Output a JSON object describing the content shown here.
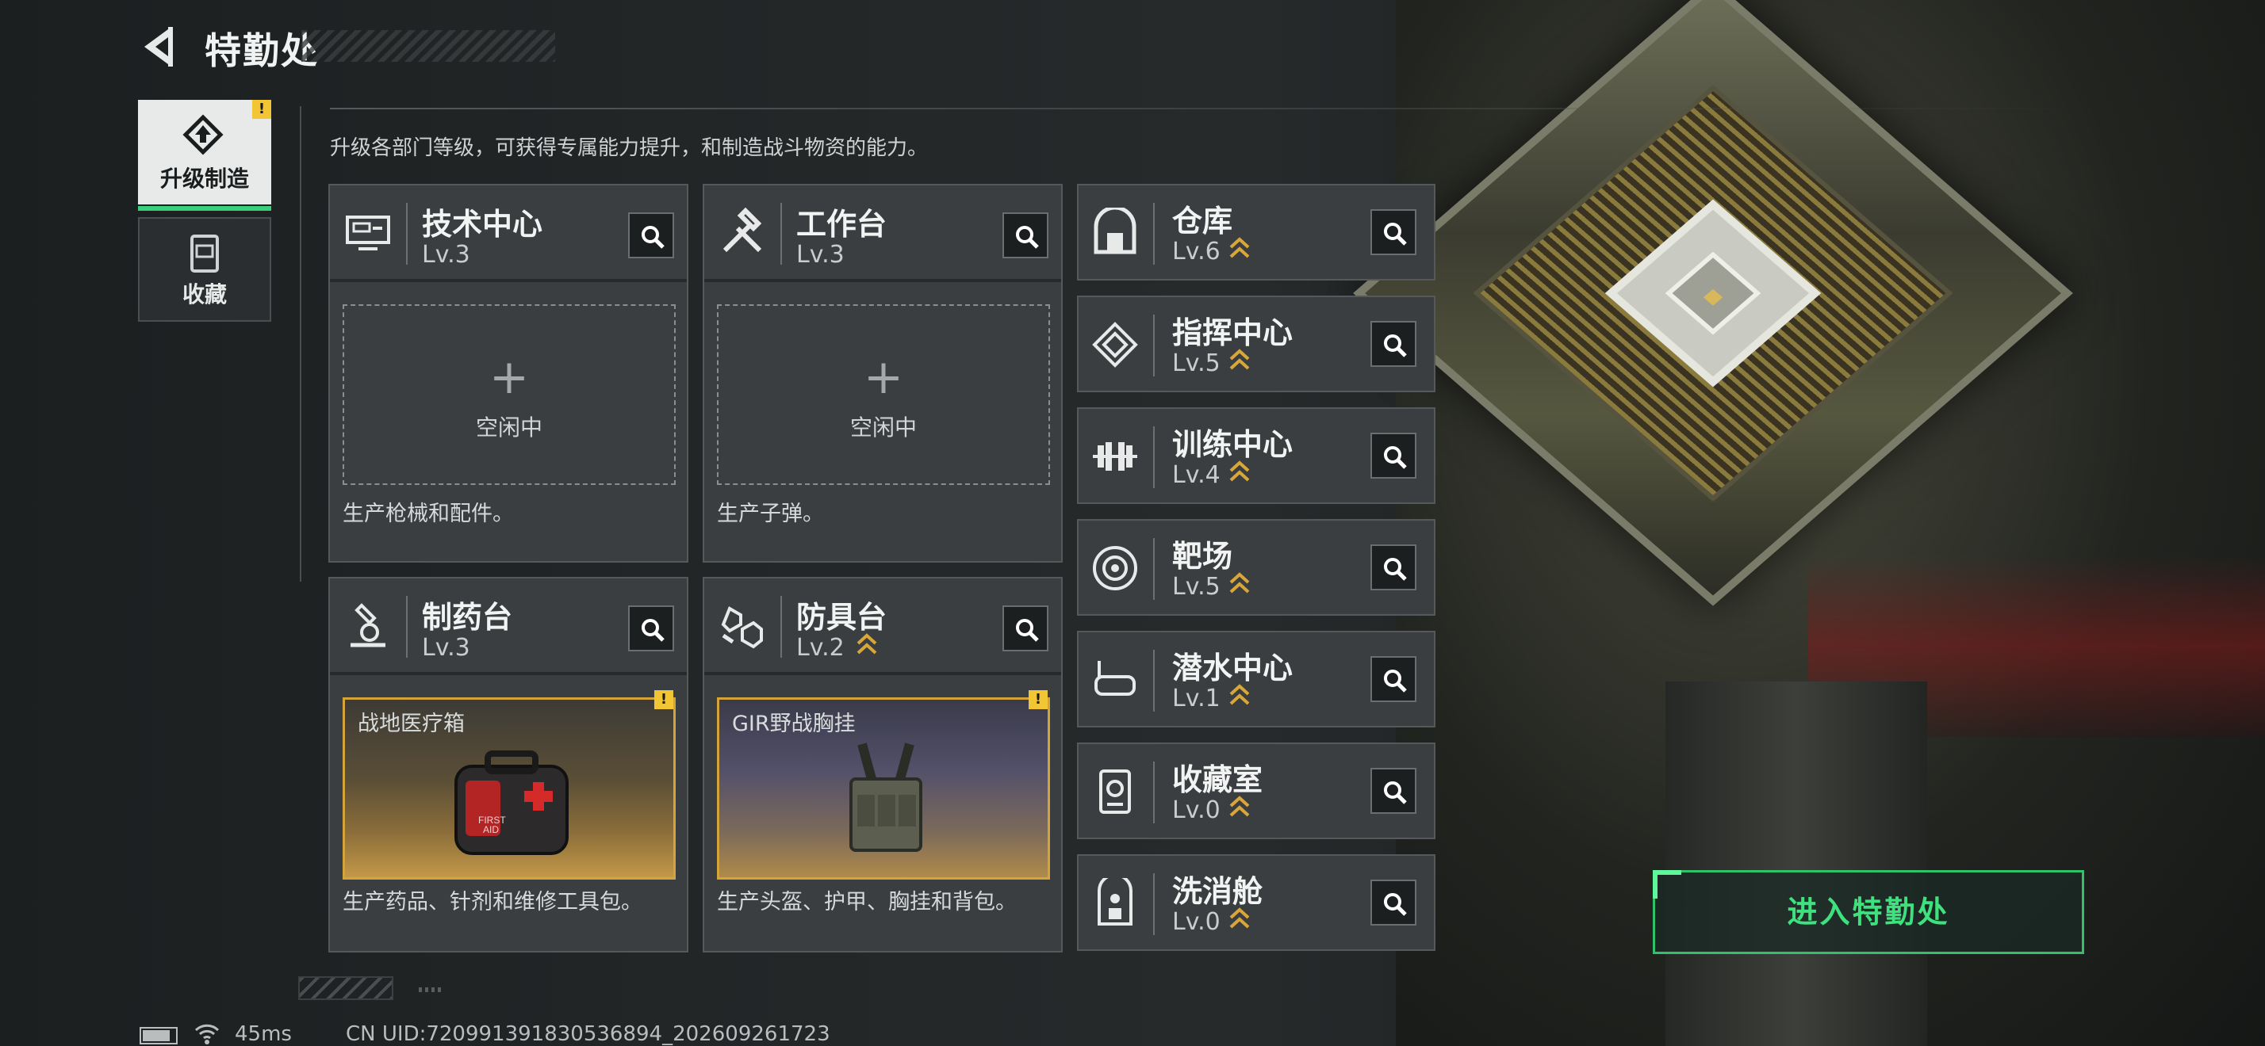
{
  "header": {
    "title": "特勤处"
  },
  "sidebar": {
    "tabs": [
      {
        "label": "升级制造",
        "active": true,
        "alert": "!"
      },
      {
        "label": "收藏",
        "active": false
      }
    ]
  },
  "description": "升级各部门等级，可获得专属能力提升，和制造战斗物资的能力。",
  "stations": [
    {
      "name": "技术中心",
      "level": "Lv.3",
      "slot_label": "空闲中",
      "product_desc": "生产枪械和配件。"
    },
    {
      "name": "工作台",
      "level": "Lv.3",
      "slot_label": "空闲中",
      "product_desc": "生产子弹。"
    },
    {
      "name": "制药台",
      "level": "Lv.3",
      "product_name": "战地医疗箱",
      "alert": "!",
      "product_desc": "生产药品、针剂和维修工具包。",
      "item_text": [
        "FIRST",
        "AID"
      ]
    },
    {
      "name": "防具台",
      "level": "Lv.2",
      "product_name": "GIR野战胸挂",
      "alert": "!",
      "product_desc": "生产头盔、护甲、胸挂和背包。"
    }
  ],
  "departments": [
    {
      "name": "仓库",
      "level": "Lv.6"
    },
    {
      "name": "指挥中心",
      "level": "Lv.5"
    },
    {
      "name": "训练中心",
      "level": "Lv.4"
    },
    {
      "name": "靶场",
      "level": "Lv.5"
    },
    {
      "name": "潜水中心",
      "level": "Lv.1"
    },
    {
      "name": "收藏室",
      "level": "Lv.0"
    },
    {
      "name": "洗消舱",
      "level": "Lv.0"
    }
  ],
  "enter_button": "进入特勤处",
  "status_bar": {
    "ping": "45ms",
    "uid": "CN UID:720991391830536894_202609261723"
  },
  "icons": {
    "back": "back-arrow-icon",
    "search": "magnifier-icon",
    "upgrade": "upgrade-arrow-icon"
  },
  "colors": {
    "accent_green": "#39d07b",
    "warning": "#f1c534",
    "upgrade_chevron": "#d9a63a"
  }
}
